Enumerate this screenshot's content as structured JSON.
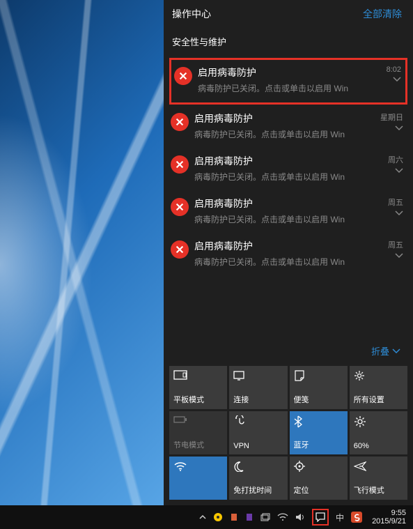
{
  "action_center": {
    "title": "操作中心",
    "clear_all": "全部清除",
    "section": "安全性与维护",
    "collapse_label": "折叠",
    "notifications": [
      {
        "title": "启用病毒防护",
        "desc": "病毒防护已关闭。点击或单击以启用 Win",
        "time": "8:02",
        "highlight": true
      },
      {
        "title": "启用病毒防护",
        "desc": "病毒防护已关闭。点击或单击以启用 Win",
        "time": "星期日",
        "highlight": false
      },
      {
        "title": "启用病毒防护",
        "desc": "病毒防护已关闭。点击或单击以启用 Win",
        "time": "周六",
        "highlight": false
      },
      {
        "title": "启用病毒防护",
        "desc": "病毒防护已关闭。点击或单击以启用 Win",
        "time": "周五",
        "highlight": false
      },
      {
        "title": "启用病毒防护",
        "desc": "病毒防护已关闭。点击或单击以启用 Win",
        "time": "周五",
        "highlight": false
      }
    ],
    "quick_actions": [
      {
        "id": "tablet-mode",
        "label": "平板模式",
        "style": "normal"
      },
      {
        "id": "connect",
        "label": "连接",
        "style": "normal"
      },
      {
        "id": "note",
        "label": "便笺",
        "style": "normal"
      },
      {
        "id": "all-settings",
        "label": "所有设置",
        "style": "normal"
      },
      {
        "id": "battery-saver",
        "label": "节电模式",
        "style": "dim"
      },
      {
        "id": "vpn",
        "label": "VPN",
        "style": "normal"
      },
      {
        "id": "bluetooth",
        "label": "蓝牙",
        "style": "blue"
      },
      {
        "id": "brightness",
        "label": "60%",
        "style": "normal"
      },
      {
        "id": "wifi",
        "label": "",
        "style": "blue"
      },
      {
        "id": "quiet-hours",
        "label": "免打扰时间",
        "style": "normal"
      },
      {
        "id": "location",
        "label": "定位",
        "style": "normal"
      },
      {
        "id": "airplane",
        "label": "飞行模式",
        "style": "normal"
      }
    ]
  },
  "taskbar": {
    "ime_indicator": "中",
    "clock_time": "9:55",
    "clock_date": "2015/9/21"
  }
}
